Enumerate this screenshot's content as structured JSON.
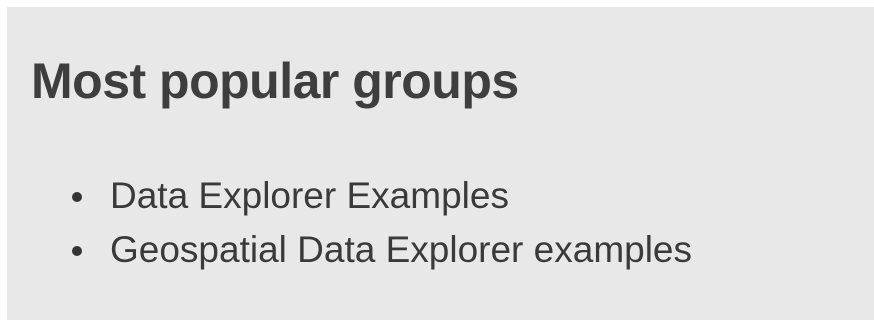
{
  "panel": {
    "title": "Most popular groups",
    "groups": [
      {
        "label": "Data Explorer Examples"
      },
      {
        "label": "Geospatial Data Explorer examples"
      }
    ]
  }
}
